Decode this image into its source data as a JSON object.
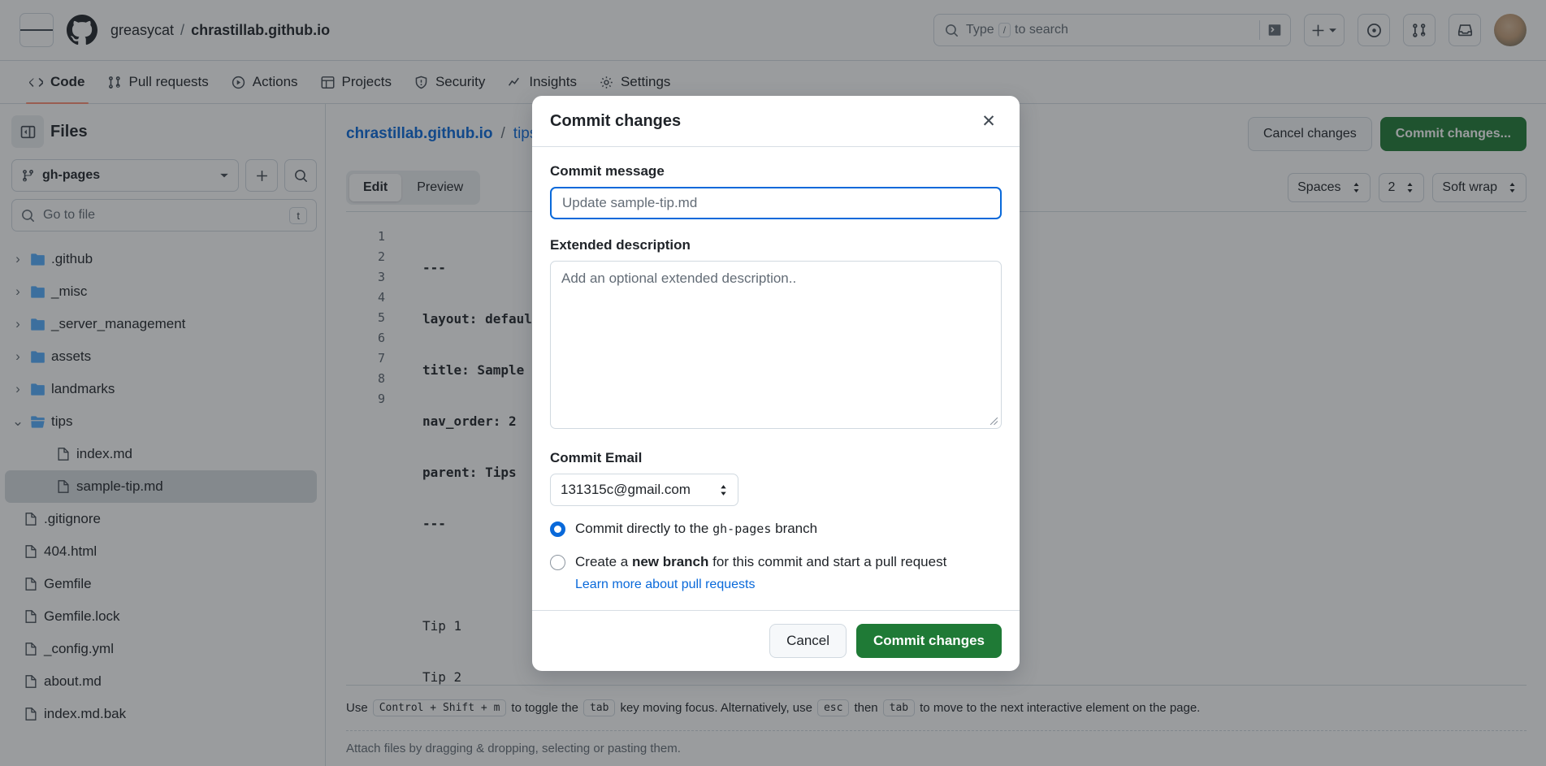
{
  "header": {
    "owner": "greasycat",
    "separator": "/",
    "repo": "chrastillab.github.io",
    "search_placeholder": "Type",
    "search_key": "/",
    "search_placeholder_tail": "to search",
    "icons": {
      "menu": "hamburger-icon",
      "logo": "github-logo-icon",
      "search": "search-icon",
      "terminal": "terminal-icon",
      "plus": "plus-icon",
      "issues": "issue-opened-icon",
      "pull_requests": "git-pull-request-icon",
      "inbox": "inbox-icon",
      "avatar": "user-avatar"
    }
  },
  "repo_nav": [
    {
      "label": "Code",
      "icon": "code-icon",
      "selected": true
    },
    {
      "label": "Pull requests",
      "icon": "git-pull-request-icon",
      "selected": false
    },
    {
      "label": "Actions",
      "icon": "play-icon",
      "selected": false
    },
    {
      "label": "Projects",
      "icon": "table-icon",
      "selected": false
    },
    {
      "label": "Security",
      "icon": "shield-icon",
      "selected": false
    },
    {
      "label": "Insights",
      "icon": "graph-icon",
      "selected": false
    },
    {
      "label": "Settings",
      "icon": "gear-icon",
      "selected": false
    }
  ],
  "sidebar": {
    "title": "Files",
    "branch": "gh-pages",
    "add_label": "+",
    "search_icon": "search-icon",
    "gotofile_placeholder": "Go to file",
    "gotofile_shortcut": "t",
    "tree": [
      {
        "name": ".github",
        "type": "folder",
        "expanded": false,
        "depth": 0
      },
      {
        "name": "_misc",
        "type": "folder",
        "expanded": false,
        "depth": 0
      },
      {
        "name": "_server_management",
        "type": "folder",
        "expanded": false,
        "depth": 0
      },
      {
        "name": "assets",
        "type": "folder",
        "expanded": false,
        "depth": 0
      },
      {
        "name": "landmarks",
        "type": "folder",
        "expanded": false,
        "depth": 0
      },
      {
        "name": "tips",
        "type": "folder",
        "expanded": true,
        "depth": 0
      },
      {
        "name": "index.md",
        "type": "file",
        "depth": 1
      },
      {
        "name": "sample-tip.md",
        "type": "file",
        "depth": 1,
        "selected": true
      },
      {
        "name": ".gitignore",
        "type": "file",
        "depth": 0
      },
      {
        "name": "404.html",
        "type": "file",
        "depth": 0
      },
      {
        "name": "Gemfile",
        "type": "file",
        "depth": 0
      },
      {
        "name": "Gemfile.lock",
        "type": "file",
        "depth": 0
      },
      {
        "name": "_config.yml",
        "type": "file",
        "depth": 0
      },
      {
        "name": "about.md",
        "type": "file",
        "depth": 0
      },
      {
        "name": "index.md.bak",
        "type": "file",
        "depth": 0
      }
    ]
  },
  "editor": {
    "breadcrumb": {
      "repo": "chrastillab.github.io",
      "sep1": "/",
      "folder": "tips",
      "sep2": "/"
    },
    "cancel_changes_label": "Cancel changes",
    "commit_changes_label": "Commit changes...",
    "tabs": [
      {
        "label": "Edit",
        "selected": true
      },
      {
        "label": "Preview",
        "selected": false
      }
    ],
    "options": [
      {
        "label": "Spaces",
        "name": "indent-mode-select"
      },
      {
        "label": "2",
        "name": "indent-size-select"
      },
      {
        "label": "Soft wrap",
        "name": "wrap-mode-select"
      }
    ],
    "line_numbers": [
      "1",
      "2",
      "3",
      "4",
      "5",
      "6",
      "7",
      "8",
      "9"
    ],
    "code_lines": [
      "---",
      "layout: default",
      "title: Sample Tip",
      "nav_order: 2",
      "parent: Tips",
      "---",
      "",
      "Tip 1",
      "Tip 2"
    ],
    "status": {
      "use": "Use",
      "kbd1": "Control + Shift + m",
      "mid1": "to toggle the",
      "kbd2": "tab",
      "mid2": "key moving focus. Alternatively, use",
      "kbd3": "esc",
      "mid3": "then",
      "kbd4": "tab",
      "tail": "to move to the next interactive element on the page."
    },
    "attach_hint": "Attach files by dragging & dropping, selecting or pasting them."
  },
  "modal": {
    "title": "Commit changes",
    "close_icon": "close-icon",
    "commit_message_label": "Commit message",
    "commit_message_placeholder": "Update sample-tip.md",
    "extended_description_label": "Extended description",
    "extended_description_placeholder": "Add an optional extended description..",
    "commit_email_label": "Commit Email",
    "commit_email_value": "131315c@gmail.com",
    "radio_direct_pre": "Commit directly to the",
    "radio_direct_branch": "gh-pages",
    "radio_direct_post": "branch",
    "radio_branch_pre": "Create a",
    "radio_branch_strong": "new branch",
    "radio_branch_post": "for this commit and start a pull request",
    "learn_more_label": "Learn more about pull requests",
    "cancel_label": "Cancel",
    "commit_label": "Commit changes"
  },
  "colors": {
    "accent": "#0969da",
    "success": "#1f7a36",
    "selected_tab_underline": "#fd8c73",
    "border": "#d1d9e0",
    "muted_text": "#636c76"
  }
}
